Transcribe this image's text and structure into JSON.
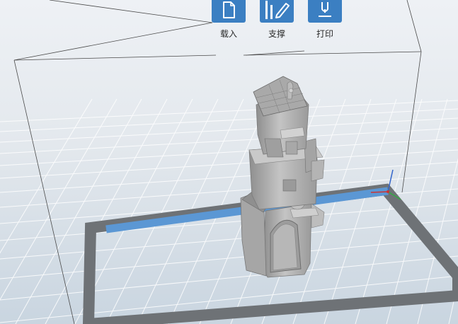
{
  "toolbar": {
    "items": [
      {
        "label": "载入",
        "icon": "file-icon"
      },
      {
        "label": "支撑",
        "icon": "support-icon"
      },
      {
        "label": "打印",
        "icon": "print-icon"
      }
    ],
    "accent_color": "#3b7fc2"
  },
  "scene": {
    "background_color": "#dfe5eb",
    "grid_color": "#ffffff",
    "model_color": "#b3b3b3",
    "build_plate_border_color": "#6e7276",
    "front_edge_color": "#5b97d4"
  }
}
